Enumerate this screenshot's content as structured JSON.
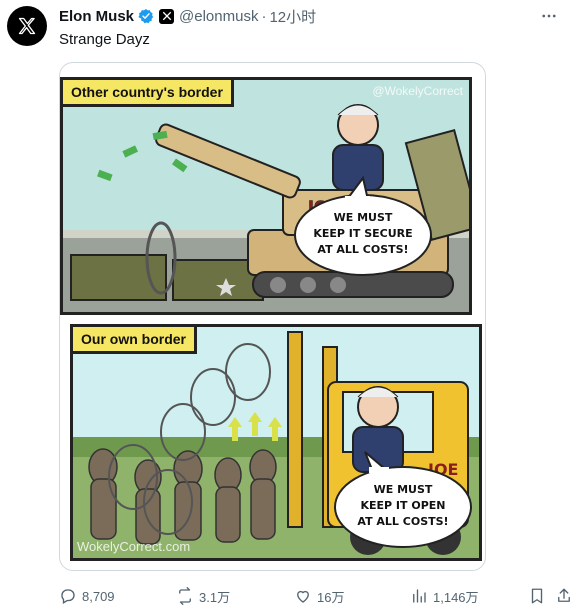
{
  "post": {
    "author_name": "Elon Musk",
    "handle": "@elonmusk",
    "separator": "·",
    "time": "12小时",
    "text": "Strange Dayz"
  },
  "comic": {
    "panel1": {
      "caption": "Other country's border",
      "watermark": "@WokelyCorrect",
      "tank_label": "JOE",
      "speech": [
        "WE MUST",
        "KEEP IT SECURE",
        "AT ALL COSTS!"
      ]
    },
    "panel2": {
      "caption": "Our own border",
      "watermark": "WokelyCorrect.com",
      "forklift_label": "JOE",
      "speech": [
        "WE MUST",
        "KEEP IT OPEN",
        "AT ALL COSTS!"
      ]
    }
  },
  "actions": {
    "replies": "8,709",
    "reposts": "3.1万",
    "likes": "16万",
    "views": "1,146万"
  },
  "icons": [
    "x-logo-icon",
    "verified-badge-icon",
    "x-affiliate-badge-icon",
    "more-icon",
    "reply-icon",
    "repost-icon",
    "like-icon",
    "views-icon",
    "bookmark-icon",
    "share-icon"
  ],
  "colors": {
    "verified": "#1d9bf0",
    "muted": "#536471",
    "caption_bg": "#f5e663"
  }
}
